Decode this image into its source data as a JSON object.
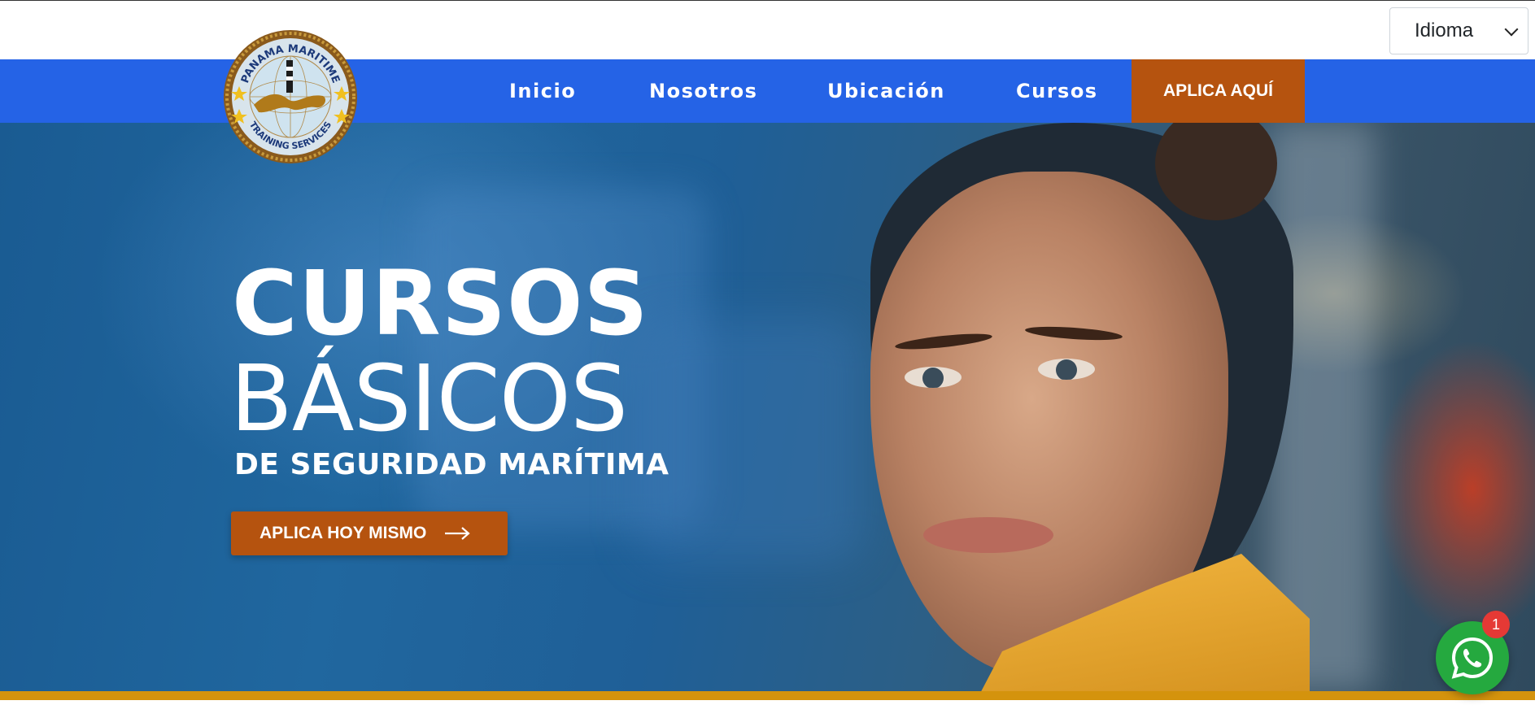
{
  "language_select": {
    "selected": "Idioma"
  },
  "brand": {
    "logo_text_top": "PANAMA MARITIME",
    "logo_text_bottom": "TRAINING SERVICES"
  },
  "nav": {
    "items": [
      {
        "label": "Inicio"
      },
      {
        "label": "Nosotros"
      },
      {
        "label": "Ubicación"
      },
      {
        "label": "Cursos"
      }
    ],
    "cta_label": "APLICA AQUÍ"
  },
  "hero": {
    "title_line1": "CURSOS",
    "title_line2": "BÁSICOS",
    "subtitle": "DE SEGURIDAD MARÍTIMA",
    "button_label": "APLICA HOY MISMO"
  },
  "whatsapp": {
    "badge_count": "1"
  },
  "colors": {
    "nav_bg": "#2563e6",
    "cta_bg": "#b5530f",
    "stripe": "#d4930d",
    "whatsapp": "#25a93f",
    "badge": "#e53935"
  }
}
